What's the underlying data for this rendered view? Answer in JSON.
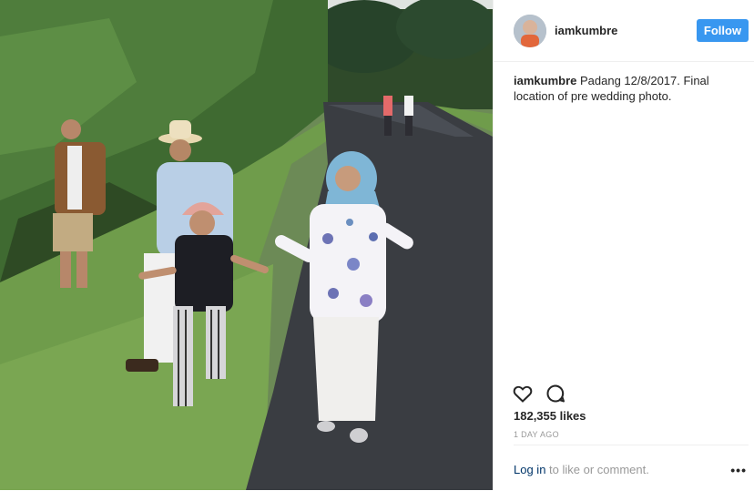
{
  "post": {
    "username": "iamkumbre",
    "follow_label": "Follow",
    "caption_user": "iamkumbre",
    "caption_text": "Padang 12/8/2017. Final location of pre wedding photo.",
    "likes": "182,355 likes",
    "time": "1 DAY AGO"
  },
  "footer": {
    "login_link": "Log in",
    "login_rest": "to like or comment."
  },
  "icons": {
    "like": "heart-icon",
    "comment": "comment-icon",
    "more": "more-options-icon"
  },
  "colors": {
    "follow_button": "#3897f0",
    "link": "#003569",
    "muted": "#999999",
    "text": "#262626"
  }
}
